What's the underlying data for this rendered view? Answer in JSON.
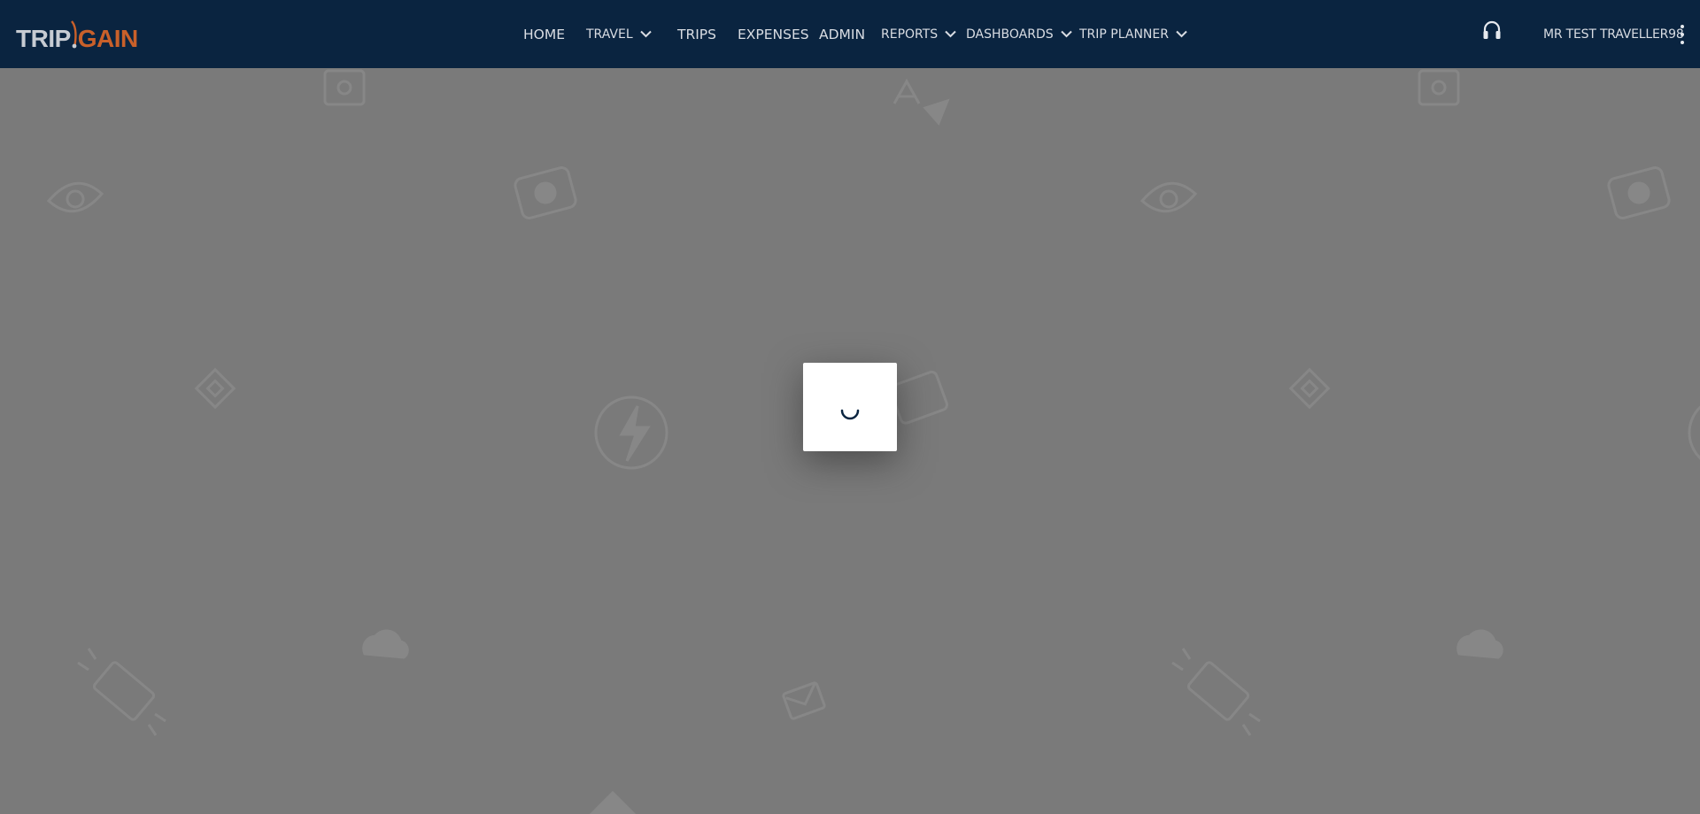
{
  "brand": {
    "logo_part1": "TRIP",
    "logo_part2": "GAIN",
    "logo_text_color": "#c7ccd3",
    "logo_accent_color": "#c9602a"
  },
  "nav": {
    "items": [
      {
        "label": "HOME",
        "has_dropdown": false
      },
      {
        "label": "TRAVEL",
        "has_dropdown": true
      },
      {
        "label": "TRIPS",
        "has_dropdown": false
      },
      {
        "label": "EXPENSES",
        "has_dropdown": false
      },
      {
        "label": "ADMIN",
        "has_dropdown": false
      },
      {
        "label": "REPORTS",
        "has_dropdown": true
      },
      {
        "label": "DASHBOARDS",
        "has_dropdown": true
      },
      {
        "label": "TRIP PLANNER",
        "has_dropdown": true
      }
    ],
    "support_icon": "headset-icon",
    "user_name": "MR TEST TRAVELLER98",
    "menu_icon": "kebab-menu-icon",
    "bar_color": "#0a2440"
  },
  "overlay": {
    "color": "#7a7a7a",
    "loading_spinner_icon": "spinner-icon",
    "spinner_color": "#0a2440"
  }
}
